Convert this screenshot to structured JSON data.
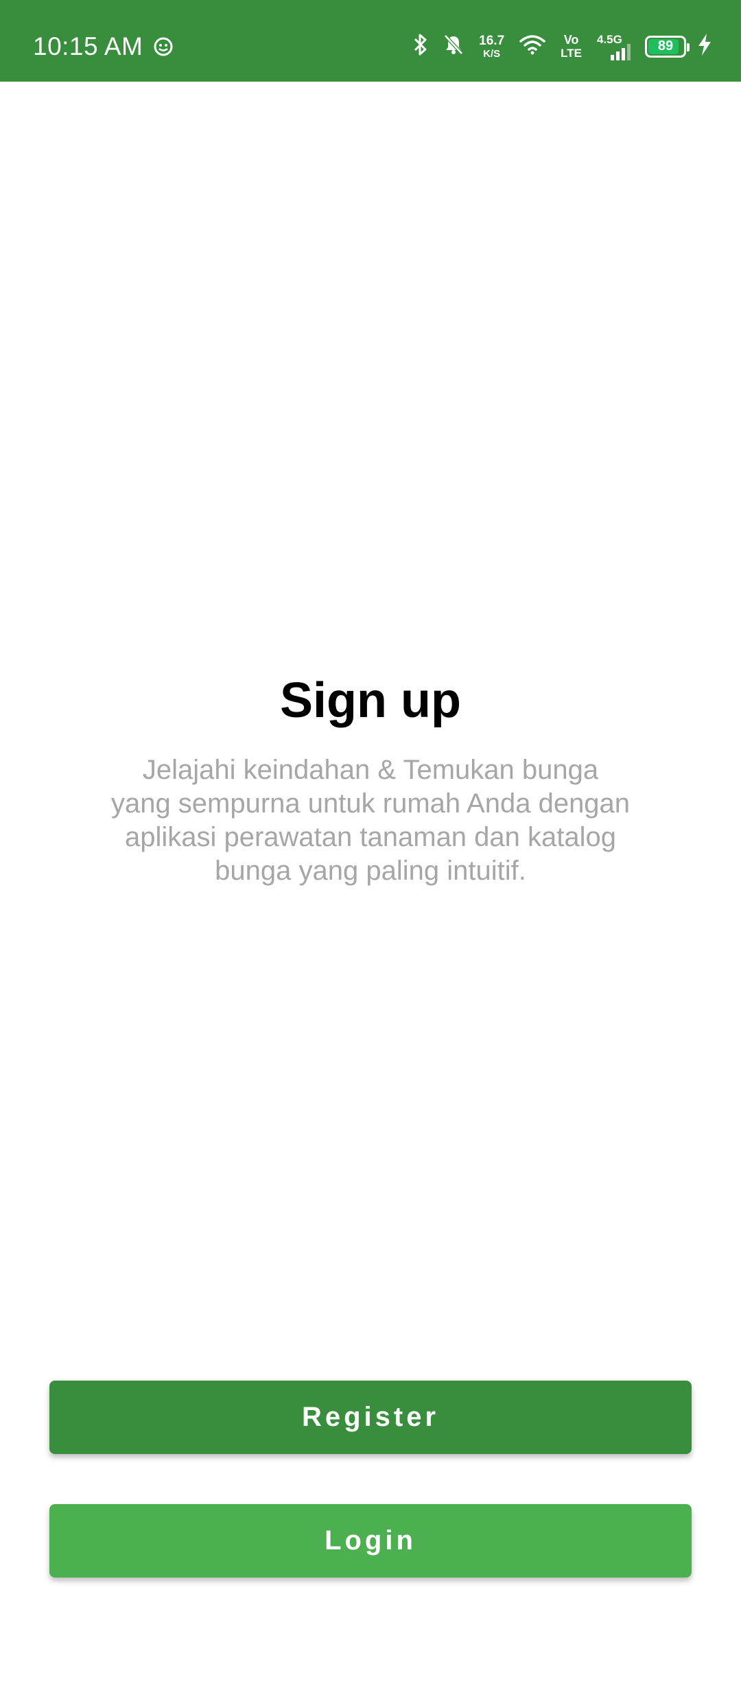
{
  "status_bar": {
    "time": "10:15 AM",
    "net_speed_value": "16.7",
    "net_speed_unit": "K/S",
    "volte_top": "Vo",
    "volte_bottom": "LTE",
    "network_gen": "4.5G",
    "battery_level": "89",
    "battery_fraction": 0.89,
    "background_color": "#388e3c",
    "icons": [
      "notification-app-icon",
      "bluetooth-icon",
      "bell-muted-icon",
      "wifi-icon",
      "signal-icon",
      "battery-icon",
      "charging-bolt-icon"
    ]
  },
  "main": {
    "title": "Sign up",
    "description_lines": [
      "Jelajahi keindahan & Temukan bunga",
      "yang sempurna untuk rumah Anda dengan",
      "aplikasi perawatan tanaman dan katalog",
      "bunga yang paling intuitif."
    ]
  },
  "actions": {
    "register_label": "Register",
    "login_label": "Login"
  },
  "colors": {
    "primary_dark": "#388e3c",
    "primary": "#4caf50",
    "subtitle_text": "#a6a6a6",
    "title_text": "#000000"
  }
}
